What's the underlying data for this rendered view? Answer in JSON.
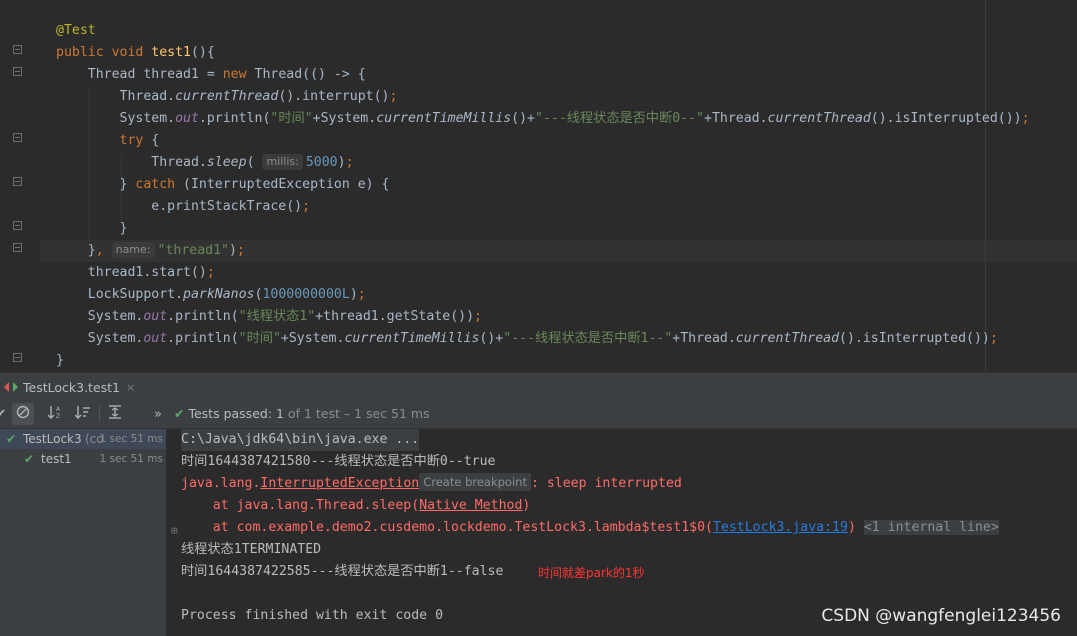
{
  "editor": {
    "lines": [
      {
        "tokens": [
          {
            "t": "@Test",
            "c": "ann"
          }
        ]
      },
      {
        "tokens": [
          {
            "t": "public ",
            "c": "kw"
          },
          {
            "t": "void ",
            "c": "kw"
          },
          {
            "t": "test1",
            "c": "fn"
          },
          {
            "t": "(){"
          }
        ]
      },
      {
        "tokens": [
          {
            "t": "    Thread thread1 = "
          },
          {
            "t": "new ",
            "c": "kw"
          },
          {
            "t": "Thread(() -> {"
          }
        ]
      },
      {
        "tokens": [
          {
            "t": "        Thread."
          },
          {
            "t": "currentThread",
            "c": "ital"
          },
          {
            "t": "().interrupt()"
          },
          {
            "t": ";",
            "c": "kw"
          }
        ]
      },
      {
        "tokens": [
          {
            "t": "        System."
          },
          {
            "t": "out",
            "c": "stat"
          },
          {
            "t": ".println("
          },
          {
            "t": "\"时间\"",
            "c": "str"
          },
          {
            "t": "+System."
          },
          {
            "t": "currentTimeMillis",
            "c": "ital"
          },
          {
            "t": "()+"
          },
          {
            "t": "\"---线程状态是否中断0--\"",
            "c": "str"
          },
          {
            "t": "+Thread."
          },
          {
            "t": "currentThread",
            "c": "ital"
          },
          {
            "t": "().isInterrupted())"
          },
          {
            "t": ";",
            "c": "kw"
          }
        ]
      },
      {
        "tokens": [
          {
            "t": "        "
          },
          {
            "t": "try ",
            "c": "kw"
          },
          {
            "t": "{"
          }
        ]
      },
      {
        "tokens": [
          {
            "t": "            Thread."
          },
          {
            "t": "sleep",
            "c": "ital"
          },
          {
            "t": "( "
          },
          {
            "t": "millis:",
            "c": "hint"
          },
          {
            "t": "5000",
            "c": "num"
          },
          {
            "t": ")"
          },
          {
            "t": ";",
            "c": "kw"
          }
        ]
      },
      {
        "tokens": [
          {
            "t": "        } "
          },
          {
            "t": "catch ",
            "c": "kw"
          },
          {
            "t": "(InterruptedException e) {"
          }
        ]
      },
      {
        "tokens": [
          {
            "t": "            e.printStackTrace()"
          },
          {
            "t": ";",
            "c": "kw"
          }
        ]
      },
      {
        "tokens": [
          {
            "t": "        }"
          }
        ]
      },
      {
        "tokens": [
          {
            "t": "    }"
          },
          {
            "t": ", ",
            "c": "kw"
          },
          {
            "t": "name:",
            "c": "hint"
          },
          {
            "t": "\"thread1\"",
            "c": "str"
          },
          {
            "t": ")"
          },
          {
            "t": ";",
            "c": "kw"
          }
        ]
      },
      {
        "tokens": [
          {
            "t": "    thread1.start()"
          },
          {
            "t": ";",
            "c": "kw"
          }
        ]
      },
      {
        "tokens": [
          {
            "t": "    LockSupport."
          },
          {
            "t": "parkNanos",
            "c": "ital"
          },
          {
            "t": "("
          },
          {
            "t": "1000000000L",
            "c": "num"
          },
          {
            "t": ")"
          },
          {
            "t": ";",
            "c": "kw"
          }
        ]
      },
      {
        "tokens": [
          {
            "t": "    System."
          },
          {
            "t": "out",
            "c": "stat"
          },
          {
            "t": ".println("
          },
          {
            "t": "\"线程状态1\"",
            "c": "str"
          },
          {
            "t": "+thread1.getState())"
          },
          {
            "t": ";",
            "c": "kw"
          }
        ]
      },
      {
        "tokens": [
          {
            "t": "    System."
          },
          {
            "t": "out",
            "c": "stat"
          },
          {
            "t": ".println("
          },
          {
            "t": "\"时间\"",
            "c": "str"
          },
          {
            "t": "+System."
          },
          {
            "t": "currentTimeMillis",
            "c": "ital"
          },
          {
            "t": "()+"
          },
          {
            "t": "\"---线程状态是否中断1--\"",
            "c": "str"
          },
          {
            "t": "+Thread."
          },
          {
            "t": "currentThread",
            "c": "ital"
          },
          {
            "t": "().isInterrupted())"
          },
          {
            "t": ";",
            "c": "kw"
          }
        ]
      },
      {
        "tokens": [
          {
            "t": "}"
          }
        ]
      }
    ]
  },
  "run_panel": {
    "tab_label": "TestLock3.test1",
    "tab_close": "×",
    "toolbar": {
      "more": "»",
      "status_prefix": "Tests passed: ",
      "passed": "1",
      "status_suffix": " of 1 test – 1 sec 51 ms"
    },
    "tree": [
      {
        "label": "TestLock3",
        "extra": " (co",
        "time": "1 sec 51 ms",
        "indent": 6
      },
      {
        "label": "test1",
        "extra": "",
        "time": "1 sec 51 ms",
        "indent": 24
      }
    ]
  },
  "console": {
    "cmd": "C:\\Java\\jdk64\\bin\\java.exe ...",
    "line1": "时间1644387421580---线程状态是否中断0--true",
    "exc_prefix": "java.lang.",
    "exc_name": "InterruptedException",
    "create_bp": "Create breakpoint",
    "exc_msg": ": sleep interrupted",
    "at1_prefix": "    at java.lang.Thread.sleep(",
    "at1_link": "Native Method",
    "at1_suffix": ")",
    "at2_prefix": "    at com.example.demo2.cusdemo.lockdemo.TestLock3.lambda$test1$0(",
    "at2_link": "TestLock3.java:19",
    "at2_suffix": ")",
    "internal": "<1 internal line>",
    "line_state": "线程状态1TERMINATED",
    "line2": "时间1644387422585---线程状态是否中断1--false",
    "note": "时间就差park的1秒",
    "finish": "Process finished with exit code 0"
  },
  "watermark": "CSDN @wangfenglei123456",
  "colors": {
    "background": "#2b2b2b",
    "panel": "#3c3f41",
    "keyword": "#cc7832",
    "string": "#6a8759",
    "number": "#6897bb",
    "error": "#ff6b68",
    "success": "#59a869"
  }
}
